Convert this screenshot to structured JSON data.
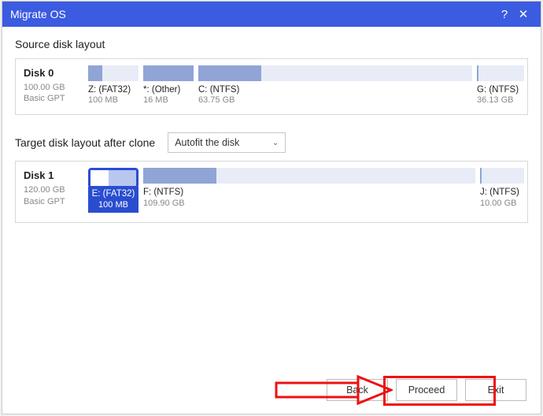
{
  "title": "Migrate OS",
  "source_label": "Source disk layout",
  "target_label": "Target disk layout after clone",
  "dropdown_value": "Autofit the disk",
  "source_disk": {
    "name": "Disk 0",
    "size": "100.00 GB",
    "style": "Basic GPT",
    "partitions": [
      {
        "label": "Z: (FAT32)",
        "size": "100 MB"
      },
      {
        "label": "*: (Other)",
        "size": "16 MB"
      },
      {
        "label": "C: (NTFS)",
        "size": "63.75 GB"
      },
      {
        "label": "G: (NTFS)",
        "size": "36.13 GB"
      }
    ]
  },
  "target_disk": {
    "name": "Disk 1",
    "size": "120.00 GB",
    "style": "Basic GPT",
    "partitions": [
      {
        "label": "E: (FAT32)",
        "size": "100 MB"
      },
      {
        "label": "F: (NTFS)",
        "size": "109.90 GB"
      },
      {
        "label": "J: (NTFS)",
        "size": "10.00 GB"
      }
    ]
  },
  "buttons": {
    "back": "Back",
    "proceed": "Proceed",
    "exit": "Exit"
  }
}
